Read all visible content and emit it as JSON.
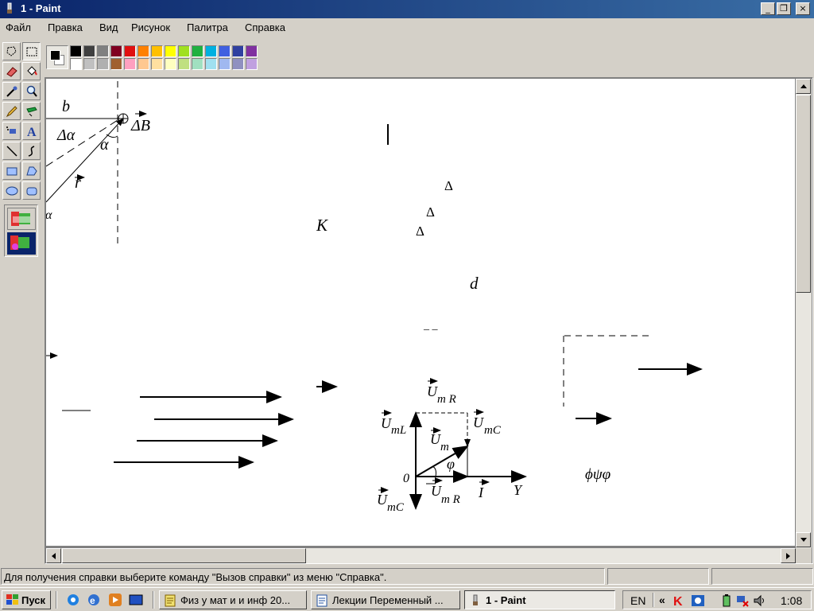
{
  "window": {
    "title": "1 - Paint"
  },
  "caption_buttons": {
    "minimize": "_",
    "restore": "❐",
    "close": "×"
  },
  "menu": [
    "Файл",
    "Правка",
    "Вид",
    "Рисунок",
    "Палитра",
    "Справка"
  ],
  "palette": {
    "top": [
      "#000000",
      "#404040",
      "#808080",
      "#800020",
      "#e01010",
      "#ff8000",
      "#ffc000",
      "#ffff00",
      "#a0e020",
      "#20b040",
      "#00b0e0",
      "#4060e0",
      "#3040a0",
      "#8030a0"
    ],
    "bottom": [
      "#ffffff",
      "#c0c0c0",
      "#b0b0b0",
      "#a06030",
      "#ffa0c0",
      "#ffc890",
      "#ffe0a0",
      "#ffffc0",
      "#c0e080",
      "#a0e0c0",
      "#a0e0f0",
      "#a0b8f0",
      "#9090c0",
      "#c0a0e0"
    ]
  },
  "drawing": {
    "b": "b",
    "delta_alpha": "Δα",
    "alpha": "α",
    "delta_b": "ΔB",
    "r": "r",
    "alpha_cut": "α",
    "delta1": "Δ",
    "delta2": "Δ",
    "delta3": "Δ",
    "k": "K",
    "d": "d",
    "dash": "_ _",
    "u_mr_top": "U",
    "u_mr_top_sub": "m R",
    "u_ml": "U",
    "u_ml_sub": "mL",
    "u_mc_right": "U",
    "u_mc_right_sub": "mC",
    "u_m": "U",
    "u_m_sub": "m",
    "phi": "φ",
    "zero": "0",
    "u_mc_bottom": "U",
    "u_mc_bottom_sub": "mC",
    "u_mr_bottom": "U",
    "u_mr_bottom_sub": "m R",
    "i": "I",
    "y": "Y",
    "phipsiphi": "ϕψφ"
  },
  "status": {
    "text": "Для получения справки выберите команду \"Вызов справки\" из меню \"Справка\"."
  },
  "taskbar": {
    "start": "Пуск",
    "tasks": [
      "Физ у мат и и инф 20...",
      "Лекции Переменный ...",
      "1 - Paint"
    ],
    "lang": "EN",
    "chevron": "«",
    "clock": "1:08"
  }
}
